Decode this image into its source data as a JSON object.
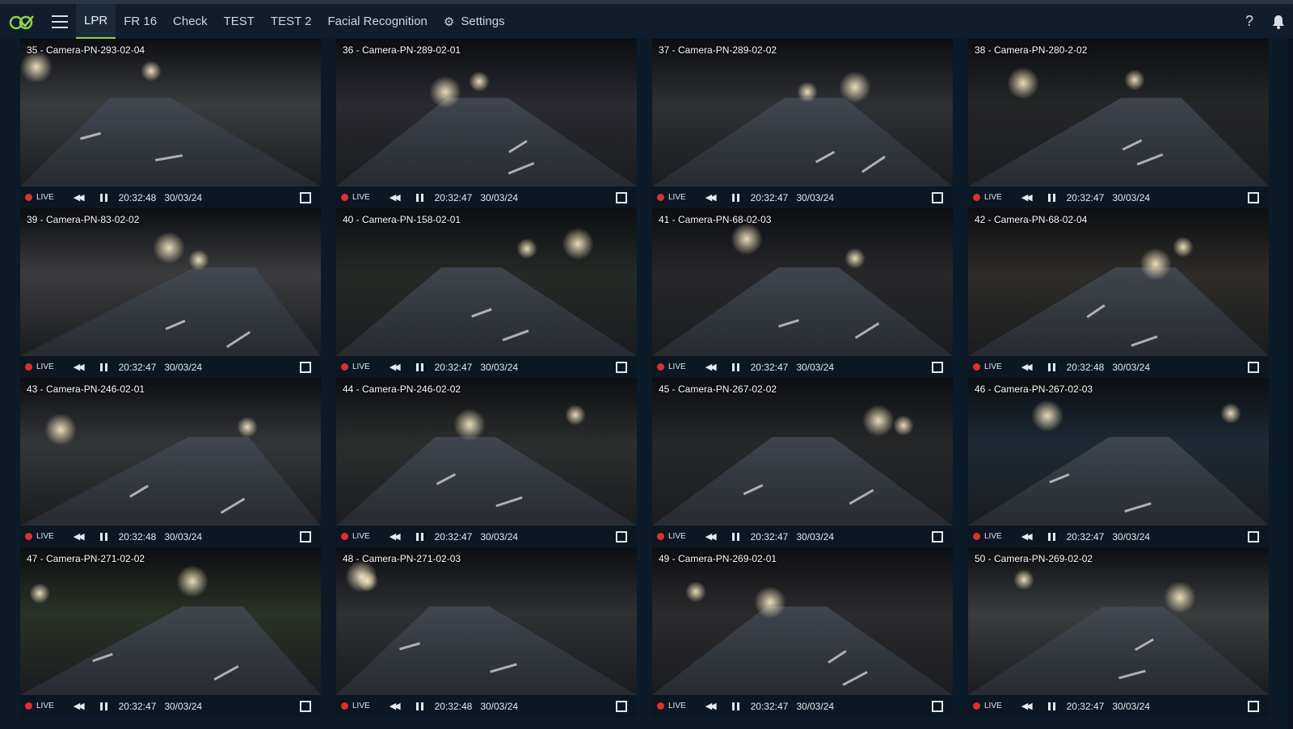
{
  "header": {
    "tabs": [
      {
        "label": "LPR",
        "active": true
      },
      {
        "label": "FR 16",
        "active": false
      },
      {
        "label": "Check",
        "active": false
      },
      {
        "label": "TEST",
        "active": false
      },
      {
        "label": "TEST 2",
        "active": false
      },
      {
        "label": "Facial Recognition",
        "active": false
      }
    ],
    "settings_label": "Settings",
    "help_glyph": "?",
    "icons": [
      "logo-icon",
      "hamburger-menu-icon",
      "gear-icon",
      "help-icon",
      "bell-icon"
    ]
  },
  "colors": {
    "accent": "#8fd14f",
    "live": "#e0302c",
    "background": "#0d1a28"
  },
  "player": {
    "live_label": "LIVE"
  },
  "cameras": [
    {
      "title": "35 - Camera-PN-293-02-04",
      "time": "20:32:48",
      "date": "30/03/24",
      "tone": "#3a3c3e"
    },
    {
      "title": "36 - Camera-PN-289-02-01",
      "time": "20:32:47",
      "date": "30/03/24",
      "tone": "#2a2a30"
    },
    {
      "title": "37 - Camera-PN-289-02-02",
      "time": "20:32:47",
      "date": "30/03/24",
      "tone": "#2e3034"
    },
    {
      "title": "38 - Camera-PN-280-2-02",
      "time": "20:32:47",
      "date": "30/03/24",
      "tone": "#252628"
    },
    {
      "title": "39 - Camera-PN-83-02-02",
      "time": "20:32:47",
      "date": "30/03/24",
      "tone": "#3c3c3e"
    },
    {
      "title": "40 - Camera-PN-158-02-01",
      "time": "20:32:47",
      "date": "30/03/24",
      "tone": "#262a26"
    },
    {
      "title": "41 - Camera-PN-68-02-03",
      "time": "20:32:47",
      "date": "30/03/24",
      "tone": "#28282a"
    },
    {
      "title": "42 - Camera-PN-68-02-04",
      "time": "20:32:48",
      "date": "30/03/24",
      "tone": "#2e2c28"
    },
    {
      "title": "43 - Camera-PN-246-02-01",
      "time": "20:32:48",
      "date": "30/03/24",
      "tone": "#343638"
    },
    {
      "title": "44 - Camera-PN-246-02-02",
      "time": "20:32:47",
      "date": "30/03/24",
      "tone": "#2c2e2e"
    },
    {
      "title": "45 - Camera-PN-267-02-02",
      "time": "20:32:47",
      "date": "30/03/24",
      "tone": "#26282a"
    },
    {
      "title": "46 - Camera-PN-267-02-03",
      "time": "20:32:47",
      "date": "30/03/24",
      "tone": "#1e2a34"
    },
    {
      "title": "47 - Camera-PN-271-02-02",
      "time": "20:32:47",
      "date": "30/03/24",
      "tone": "#2a3226"
    },
    {
      "title": "48 - Camera-PN-271-02-03",
      "time": "20:32:48",
      "date": "30/03/24",
      "tone": "#2e3032"
    },
    {
      "title": "49 - Camera-PN-269-02-01",
      "time": "20:32:47",
      "date": "30/03/24",
      "tone": "#2c2a2c"
    },
    {
      "title": "50 - Camera-PN-269-02-02",
      "time": "20:32:47",
      "date": "30/03/24",
      "tone": "#3a3c3e"
    }
  ]
}
